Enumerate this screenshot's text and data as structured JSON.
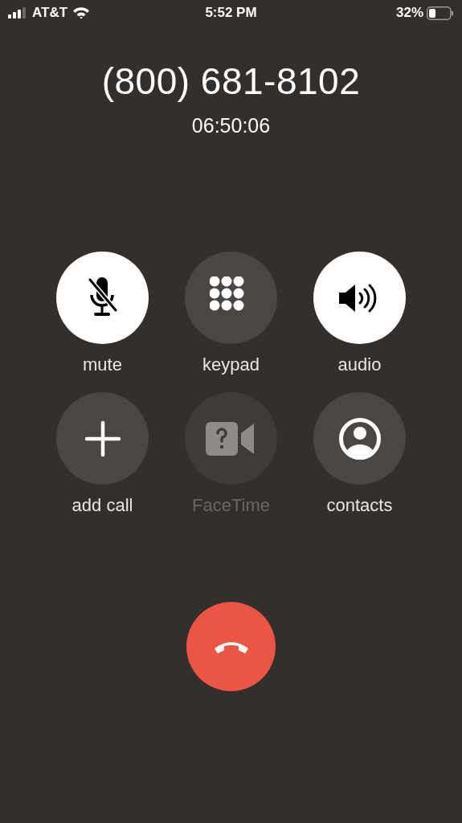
{
  "status_bar": {
    "carrier": "AT&T",
    "time": "5:52 PM",
    "battery": "32%"
  },
  "call": {
    "number": "(800) 681-8102",
    "duration": "06:50:06"
  },
  "controls": [
    {
      "kind": "mute",
      "label": "mute",
      "on": true,
      "disabled": false
    },
    {
      "kind": "keypad",
      "label": "keypad",
      "on": false,
      "disabled": false
    },
    {
      "kind": "audio",
      "label": "audio",
      "on": true,
      "disabled": false
    },
    {
      "kind": "add",
      "label": "add call",
      "on": false,
      "disabled": false
    },
    {
      "kind": "facetime",
      "label": "FaceTime",
      "on": false,
      "disabled": true
    },
    {
      "kind": "contacts",
      "label": "contacts",
      "on": false,
      "disabled": false
    }
  ]
}
